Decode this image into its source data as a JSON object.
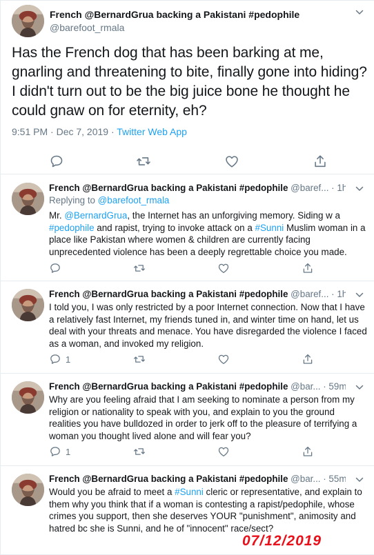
{
  "main": {
    "display_name": "French @BernardGrua backing a Pakistani #pedophile",
    "handle": "@barefoot_rmala",
    "text": "Has the French dog that has been barking at me, gnarling and threatening to bite, finally gone into hiding? I didn't turn out to be the big juice bone he thought he could gnaw on for eternity, eh?",
    "time_date": "9:51 PM · Dec 7, 2019 · ",
    "source": "Twitter Web App"
  },
  "replies": [
    {
      "display_name": "French @BernardGrua backing a Pakistani #pedophile",
      "handle_time": " @baref... · 1h",
      "replying_label": "Replying to ",
      "replying_to": "@barefoot_rmala",
      "body": {
        "p1": "Mr. ",
        "l1": "@BernardGrua",
        "p2": ", the Internet has an unforgiving memory. Siding w a ",
        "l2": "#pedophile",
        "p3": " and rapist, trying to invoke attack on a ",
        "l3": "#Sunni",
        "p4": " Muslim woman in a place like Pakistan where women & children are currently facing unprecedented violence has been a deeply regrettable choice you made."
      },
      "reply_count": ""
    },
    {
      "display_name": "French @BernardGrua backing a Pakistani #pedophile",
      "handle_time": " @baref... · 1h",
      "body": "I told you, I was only restricted by a poor Internet connection. Now that I have a relatively fast Internet, my friends tuned in, and winter time on hand, let us deal with your threats and menace. You have disregarded the violence I faced as a woman, and invoked my religion.",
      "reply_count": "1"
    },
    {
      "display_name": "French @BernardGrua backing a Pakistani #pedophile",
      "handle_time": " @bar... · 59m",
      "body": "Why are you feeling afraid that I am seeking to nominate a person from my religion or nationality to speak with you, and explain to you the ground realities you have bulldozed in order to jerk off to the pleasure of terrifying a woman you thought lived alone and will fear you?",
      "reply_count": "1"
    },
    {
      "display_name": "French @BernardGrua backing a Pakistani #pedophile",
      "handle_time": " @bar... · 55m",
      "body": {
        "p1": "Would you be afraid to meet a ",
        "l1": "#Sunni",
        "p2": " cleric or representative, and explain to them why you think that if a woman is contesting a rapist/pedophile, whose crimes you support, then she deserves YOUR \"punishment\", animosity and hatred bc she is Sunni, and he of \"innocent\" race/sect?"
      }
    }
  ],
  "stamp": "07/12/2019",
  "icons": [
    "reply-icon",
    "retweet-icon",
    "like-icon",
    "share-icon",
    "chevron-down-icon"
  ],
  "colors": {
    "link": "#1da1f2",
    "muted": "#657786",
    "text": "#14171a",
    "stamp": "#e8101a",
    "divider": "#e6ecf0"
  }
}
